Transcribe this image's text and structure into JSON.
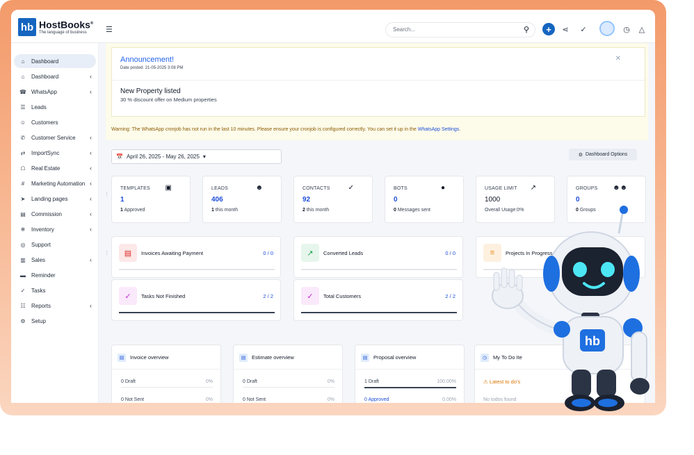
{
  "brand": {
    "logo_mark": "hb",
    "name": "HostBooks",
    "reg": "®",
    "tagline": "The language of business"
  },
  "topbar": {
    "search_placeholder": "Search...",
    "icons": [
      "menu-icon",
      "search-icon",
      "plus-icon",
      "share-icon",
      "check-icon",
      "avatar",
      "clock-icon",
      "bell-icon"
    ]
  },
  "sidebar": {
    "items": [
      {
        "label": "Dashboard",
        "icon": "home-icon",
        "active": true,
        "chevron": false
      },
      {
        "label": "Dashboard",
        "icon": "home-icon",
        "chevron": true
      },
      {
        "label": "WhatsApp",
        "icon": "whatsapp-icon",
        "chevron": true
      },
      {
        "label": "Leads",
        "icon": "leads-icon",
        "chevron": false
      },
      {
        "label": "Customers",
        "icon": "user-icon",
        "chevron": false
      },
      {
        "label": "Customer Service",
        "icon": "headset-icon",
        "chevron": true
      },
      {
        "label": "ImportSync",
        "icon": "sync-icon",
        "chevron": true
      },
      {
        "label": "Real Estate",
        "icon": "building-icon",
        "chevron": true
      },
      {
        "label": "Marketing Automation",
        "icon": "hash-icon",
        "chevron": true
      },
      {
        "label": "Landing pages",
        "icon": "send-icon",
        "chevron": true
      },
      {
        "label": "Commission",
        "icon": "money-icon",
        "chevron": true
      },
      {
        "label": "Inventory",
        "icon": "snowflake-icon",
        "chevron": true
      },
      {
        "label": "Support",
        "icon": "support-icon",
        "chevron": false
      },
      {
        "label": "Sales",
        "icon": "sales-icon",
        "chevron": true
      },
      {
        "label": "Reminder",
        "icon": "reminder-icon",
        "chevron": false
      },
      {
        "label": "Tasks",
        "icon": "check-circle-icon",
        "chevron": false
      },
      {
        "label": "Reports",
        "icon": "reports-icon",
        "chevron": true
      },
      {
        "label": "Setup",
        "icon": "gear-icon",
        "chevron": false
      }
    ]
  },
  "announcement": {
    "title": "Announcement!",
    "date": "Date posted: 21-05-2025 3:08 PM",
    "heading": "New Property listed",
    "body": "30 % discount offer on Medium properties"
  },
  "warning": {
    "text": "Warning: The WhatsApp cronjob has not run in the last 10 minutes. Please ensure your cronjob is configured correctly. You can set it up in the ",
    "link": "WhatsApp Settings",
    "end": "."
  },
  "filters": {
    "date_range": "April 26, 2025 - May 26, 2025",
    "dashboard_options": "Dashboard Options"
  },
  "stats": [
    {
      "label": "TEMPLATES",
      "icon": "templates-icon",
      "value": "1",
      "sub_bold": "1",
      "sub": " Approved"
    },
    {
      "label": "LEADS",
      "icon": "user-icon",
      "value": "406",
      "sub_bold": "1",
      "sub": " this month"
    },
    {
      "label": "CONTACTS",
      "icon": "check-icon",
      "value": "92",
      "sub_bold": "2",
      "sub": " this month"
    },
    {
      "label": "BOTS",
      "icon": "chat-icon",
      "value": "0",
      "sub_bold": "0",
      "sub": " Messages sent"
    },
    {
      "label": "USAGE LIMIT",
      "icon": "chart-icon",
      "value": "1000",
      "sub_bold": "",
      "sub": "Overall Usage:0%"
    },
    {
      "label": "GROUPS",
      "icon": "groups-icon",
      "value": "0",
      "sub_bold": "0",
      "sub": " Groups"
    }
  ],
  "progress": [
    {
      "label": "Invoices Awaiting Payment",
      "value": "0 / 0",
      "fraction": 0,
      "icon": "invoice-icon",
      "color": "#fde8e8"
    },
    {
      "label": "Converted Leads",
      "value": "0 / 0",
      "fraction": 0,
      "icon": "trend-icon",
      "color": "#e6f6ec"
    },
    {
      "label": "Projects In Progress",
      "value": "",
      "fraction": 0,
      "icon": "sliders-icon",
      "color": "#fdf0df"
    },
    {
      "label": "Tasks Not Finished",
      "value": "2 / 2",
      "fraction": 1,
      "icon": "task-icon",
      "color": "#fae8fb"
    },
    {
      "label": "Total Customers",
      "value": "2 / 2",
      "fraction": 1,
      "icon": "customers-icon",
      "color": "#fae8fb"
    }
  ],
  "overviews": [
    {
      "title": "Invoice overview",
      "rows": [
        {
          "label": "0 Draft",
          "pct": "0%"
        },
        {
          "label": "0 Not Sent",
          "pct": "0%"
        }
      ]
    },
    {
      "title": "Estimate overview",
      "rows": [
        {
          "label": "0 Draft",
          "pct": "0%"
        },
        {
          "label": "0 Not Sent",
          "pct": "0%"
        }
      ]
    },
    {
      "title": "Proposal overview",
      "rows": [
        {
          "label": "1 Draft",
          "pct": "100.00%"
        },
        {
          "label": "0 Approved",
          "pct": "0.00%"
        }
      ]
    }
  ],
  "todo": {
    "title": "My To Do Ite",
    "latest": "Latest to do's",
    "empty": "No todos found"
  },
  "robot": {
    "badge": "hb"
  }
}
